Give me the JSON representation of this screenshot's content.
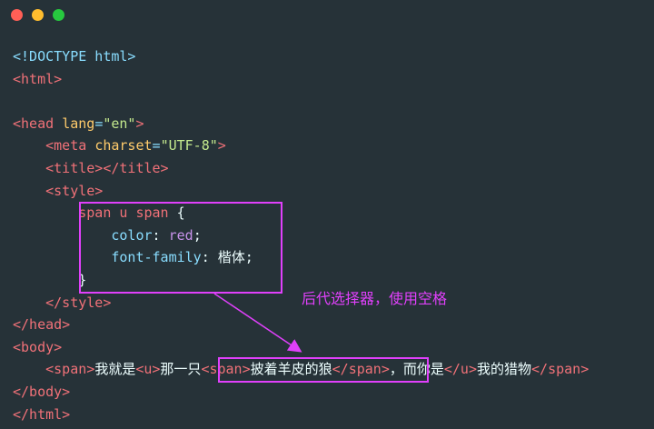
{
  "window": {
    "buttons": [
      "close",
      "minimize",
      "maximize"
    ]
  },
  "code": {
    "doctype": "<!DOCTYPE html>",
    "html_open": "<html>",
    "head_open_tag": "<head",
    "head_attr": "lang",
    "head_eq": "=",
    "head_val": "\"en\"",
    "head_close_bracket": ">",
    "meta_tag": "<meta",
    "meta_attr": "charset",
    "meta_eq": "=",
    "meta_val": "\"UTF-8\"",
    "meta_close": ">",
    "title_line": "<title></title>",
    "style_open": "<style>",
    "css_selector": "span u span",
    "css_open_brace": " {",
    "css_prop1": "color",
    "css_colon1": ": ",
    "css_val1": "red",
    "css_semi1": ";",
    "css_prop2": "font-family",
    "css_colon2": ": ",
    "css_val2": "楷体",
    "css_semi2": ";",
    "css_close_brace": "}",
    "style_close": "</style>",
    "head_close": "</head>",
    "body_open": "<body>",
    "span_open": "<span>",
    "text1": "我就是",
    "u_open": "<u>",
    "text2": "那一只",
    "inner_span_open": "<span>",
    "text3": "披着羊皮的狼",
    "inner_span_close": "</span>",
    "text4": "，而你是",
    "u_close": "</u>",
    "text5": "我的猎物",
    "span_close": "</span>",
    "body_close": "</body>",
    "html_close": "</html>"
  },
  "annotation": {
    "text": "后代选择器，使用空格"
  },
  "colors": {
    "background": "#263238",
    "highlight": "#e040fb"
  }
}
